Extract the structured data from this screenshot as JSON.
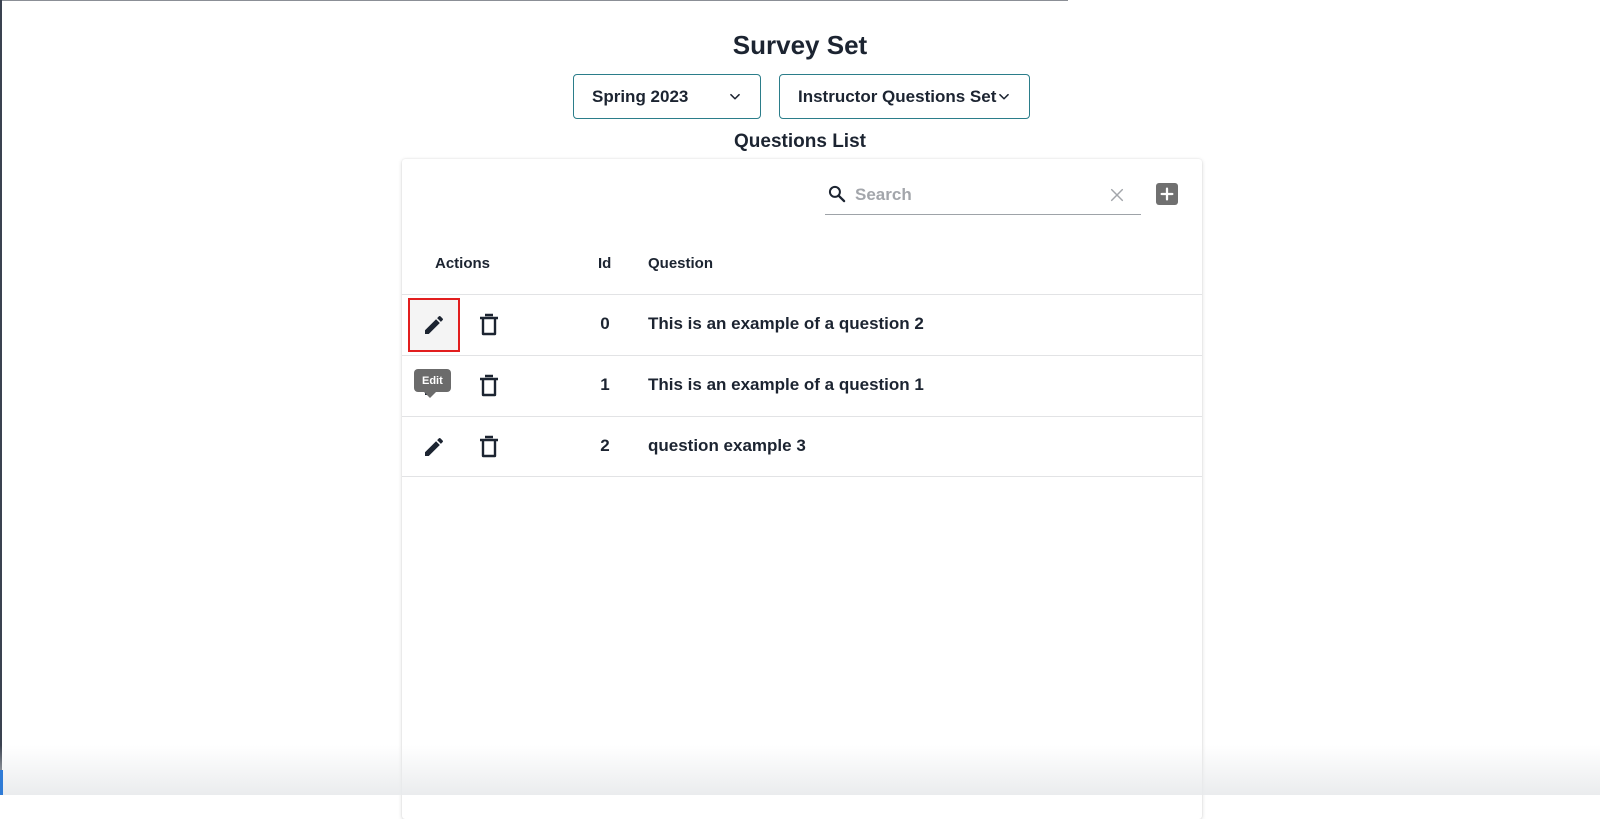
{
  "page": {
    "title": "Survey Set"
  },
  "selectors": {
    "term": {
      "value": "Spring 2023"
    },
    "question_set": {
      "value": "Instructor Questions Set"
    }
  },
  "questions_list": {
    "title": "Questions List",
    "search": {
      "placeholder": "Search",
      "value": ""
    },
    "columns": {
      "actions": "Actions",
      "id": "Id",
      "question": "Question"
    },
    "rows": [
      {
        "id": "0",
        "question": "This is an example of a question 2"
      },
      {
        "id": "1",
        "question": "This is an example of a question 1"
      },
      {
        "id": "2",
        "question": "question example 3"
      }
    ],
    "tooltip": "Edit"
  },
  "colors": {
    "accent_border": "#2b7d8a",
    "highlight_border": "#e21e1e",
    "tooltip_bg": "#6b6b6b",
    "add_button_bg": "#707070"
  },
  "icons": {
    "dropdown": "chevron-down-icon",
    "search": "search-icon",
    "clear": "close-icon",
    "add": "plus-square-icon",
    "edit": "pencil-icon",
    "delete": "trash-icon"
  }
}
